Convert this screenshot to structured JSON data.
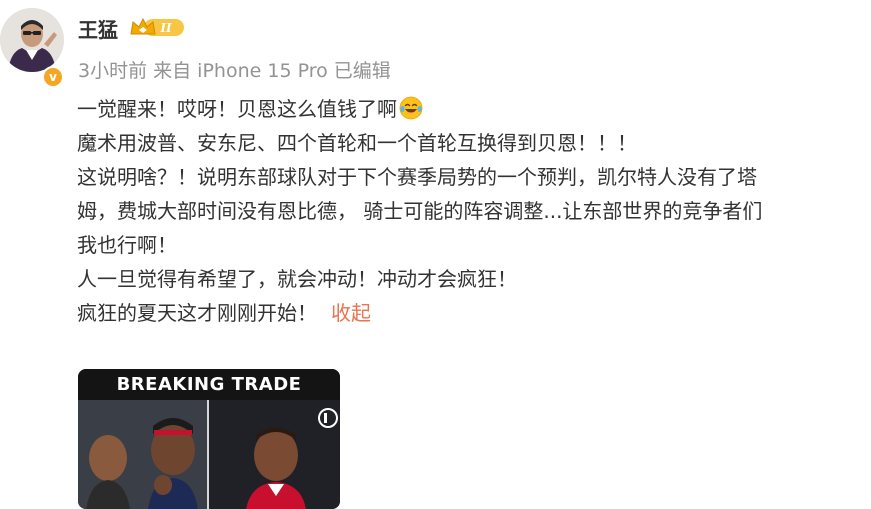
{
  "author": {
    "name": "王猛",
    "vip_level": "II",
    "verified_mark": "v"
  },
  "meta": {
    "time": "3小时前",
    "source": "来自 iPhone 15 Pro",
    "edited": "已编辑"
  },
  "post": {
    "lines": [
      "一觉醒来！哎呀！贝恩这么值钱了啊",
      "魔术用波普、安东尼、四个首轮和一个首轮互换得到贝恩！！！",
      "这说明啥？！说明东部球队对于下个赛季局势的一个预判，凯尔特人没有了塔",
      "姆，费城大部时间没有恩比德， 骑士可能的阵容调整...让东部世界的竞争者们",
      "我也行啊！",
      "人一旦觉得有希望了，就会冲动！冲动才会疯狂！",
      "疯狂的夏天这才刚刚开始！"
    ],
    "emoji": "laughing-tears-icon",
    "collapse_label": "收起"
  },
  "media": {
    "banner_text": "BREAKING TRADE"
  },
  "colors": {
    "link": "#eb7350",
    "meta": "#939393",
    "text": "#333333",
    "verified": "#f5a623"
  }
}
